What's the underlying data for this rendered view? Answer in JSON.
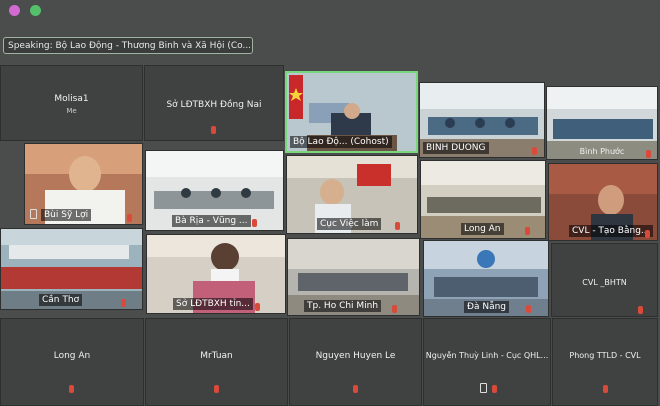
{
  "top_icons": [
    {
      "name": "record-indicator-icon",
      "color": "#d16bd1"
    },
    {
      "name": "signal-icon",
      "color": "#55c06b"
    }
  ],
  "speaking": {
    "text": "Speaking: Bộ Lao Động - Thương Binh và Xã Hội (Co..."
  },
  "tiles": {
    "molisa1": {
      "name": "Molisa1",
      "sub": "Me"
    },
    "dongnai": {
      "name": "Sở LĐTBXH Đồng Nai"
    },
    "bolaodong": {
      "name": "Bộ Lao Độ... (Cohost)"
    },
    "binhduong": {
      "name": "BINH DUONG"
    },
    "binhphuoc": {
      "name": "Bình Phước"
    },
    "buisyloi": {
      "name": "Bùi Sỹ Lợi"
    },
    "bariavung": {
      "name": "Bà Rịa - Vũng ..."
    },
    "cucvieclam": {
      "name": "Cục Việc làm"
    },
    "longan_video": {
      "name": "Long An"
    },
    "cvl_taobang": {
      "name": "CVL - Tạo Bằng..."
    },
    "cantho": {
      "name": "Cần Thơ"
    },
    "soldtbxh_tinh": {
      "name": "Sở LĐTBXH tỉn..."
    },
    "hcm": {
      "name": "Tp. Ho Chi Minh"
    },
    "danang": {
      "name": "Đà Nẵng"
    },
    "cvl_bhtn": {
      "name": "CVL _BHTN"
    },
    "longan": {
      "name": "Long An"
    },
    "mrtuan": {
      "name": "MrTuan"
    },
    "nguyenhuyenle": {
      "name": "Nguyen Huyen Le"
    },
    "thuylinh": {
      "name": "Nguyễn Thuỳ Linh - Cục QHL..."
    },
    "phongttld": {
      "name": "Phong TTLD - CVL"
    }
  },
  "colors": {
    "muted_mic": "#d94a3a",
    "active_speaker_border": "#7ad67a"
  }
}
